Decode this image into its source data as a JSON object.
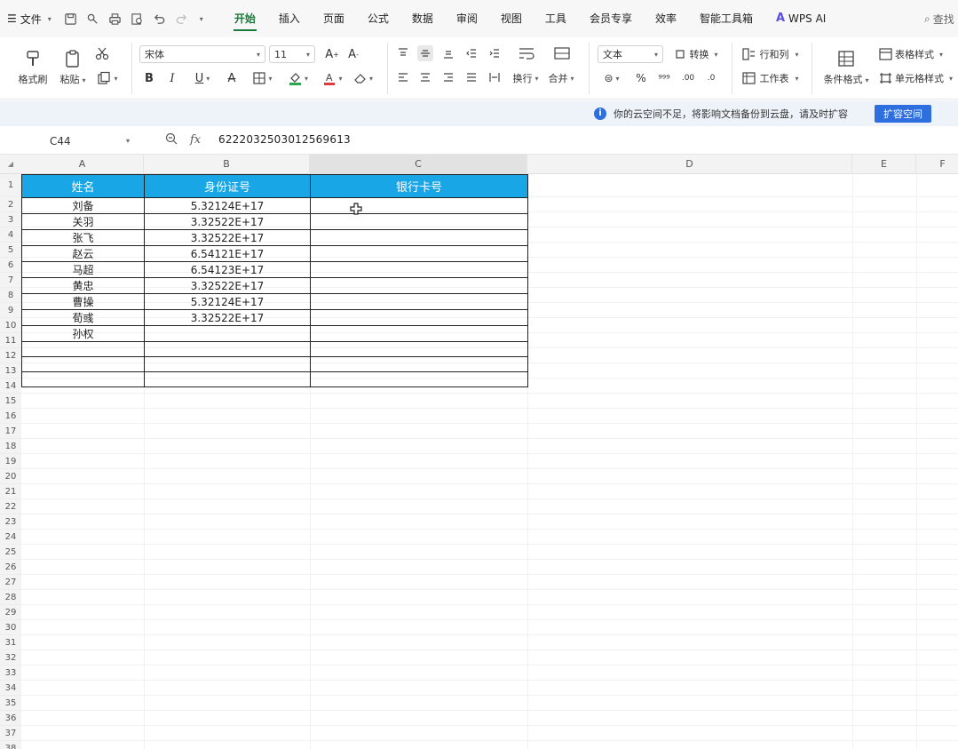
{
  "menu": {
    "file_label": "文件",
    "tabs": [
      "开始",
      "插入",
      "页面",
      "公式",
      "数据",
      "审阅",
      "视图",
      "工具",
      "会员专享",
      "效率",
      "智能工具箱"
    ],
    "active_tab": "开始",
    "ai_label": "WPS AI",
    "search_label": "查找"
  },
  "ribbon": {
    "format_painter": "格式刷",
    "paste": "粘贴",
    "font_name": "宋体",
    "font_size": "11",
    "bold": "B",
    "italic": "I",
    "underline": "U",
    "wrap": "换行",
    "merge": "合并",
    "number_format": "文本",
    "convert": "转换",
    "rows_cols": "行和列",
    "worksheet": "工作表",
    "conditional_format": "条件格式",
    "table_style": "表格样式",
    "cell_style": "单元格样式"
  },
  "notice": {
    "text": "你的云空间不足，将影响文档备份到云盘，请及时扩容",
    "button": "扩容空间"
  },
  "formula_bar": {
    "cell_ref": "C44",
    "value": "6222032503012569613"
  },
  "sheet": {
    "columns": [
      "A",
      "B",
      "C",
      "D",
      "E",
      "F"
    ],
    "selected_column": "C",
    "row_count": 38,
    "headers": [
      "姓名",
      "身份证号",
      "银行卡号"
    ],
    "rows": [
      {
        "name": "刘备",
        "id": "5.32124E+17",
        "card": ""
      },
      {
        "name": "关羽",
        "id": "3.32522E+17",
        "card": ""
      },
      {
        "name": "张飞",
        "id": "3.32522E+17",
        "card": ""
      },
      {
        "name": "赵云",
        "id": "6.54121E+17",
        "card": ""
      },
      {
        "name": "马超",
        "id": "6.54123E+17",
        "card": ""
      },
      {
        "name": "黄忠",
        "id": "3.32522E+17",
        "card": ""
      },
      {
        "name": "曹操",
        "id": "5.32124E+17",
        "card": ""
      },
      {
        "name": "荀彧",
        "id": "3.32522E+17",
        "card": ""
      },
      {
        "name": "孙权",
        "id": "",
        "card": ""
      },
      {
        "name": "",
        "id": "",
        "card": ""
      },
      {
        "name": "",
        "id": "",
        "card": ""
      },
      {
        "name": "",
        "id": "",
        "card": ""
      }
    ]
  },
  "colors": {
    "header_fill": "#19a6e6",
    "active_tab": "#1b7a3a",
    "notice_button": "#2e6fe0"
  }
}
